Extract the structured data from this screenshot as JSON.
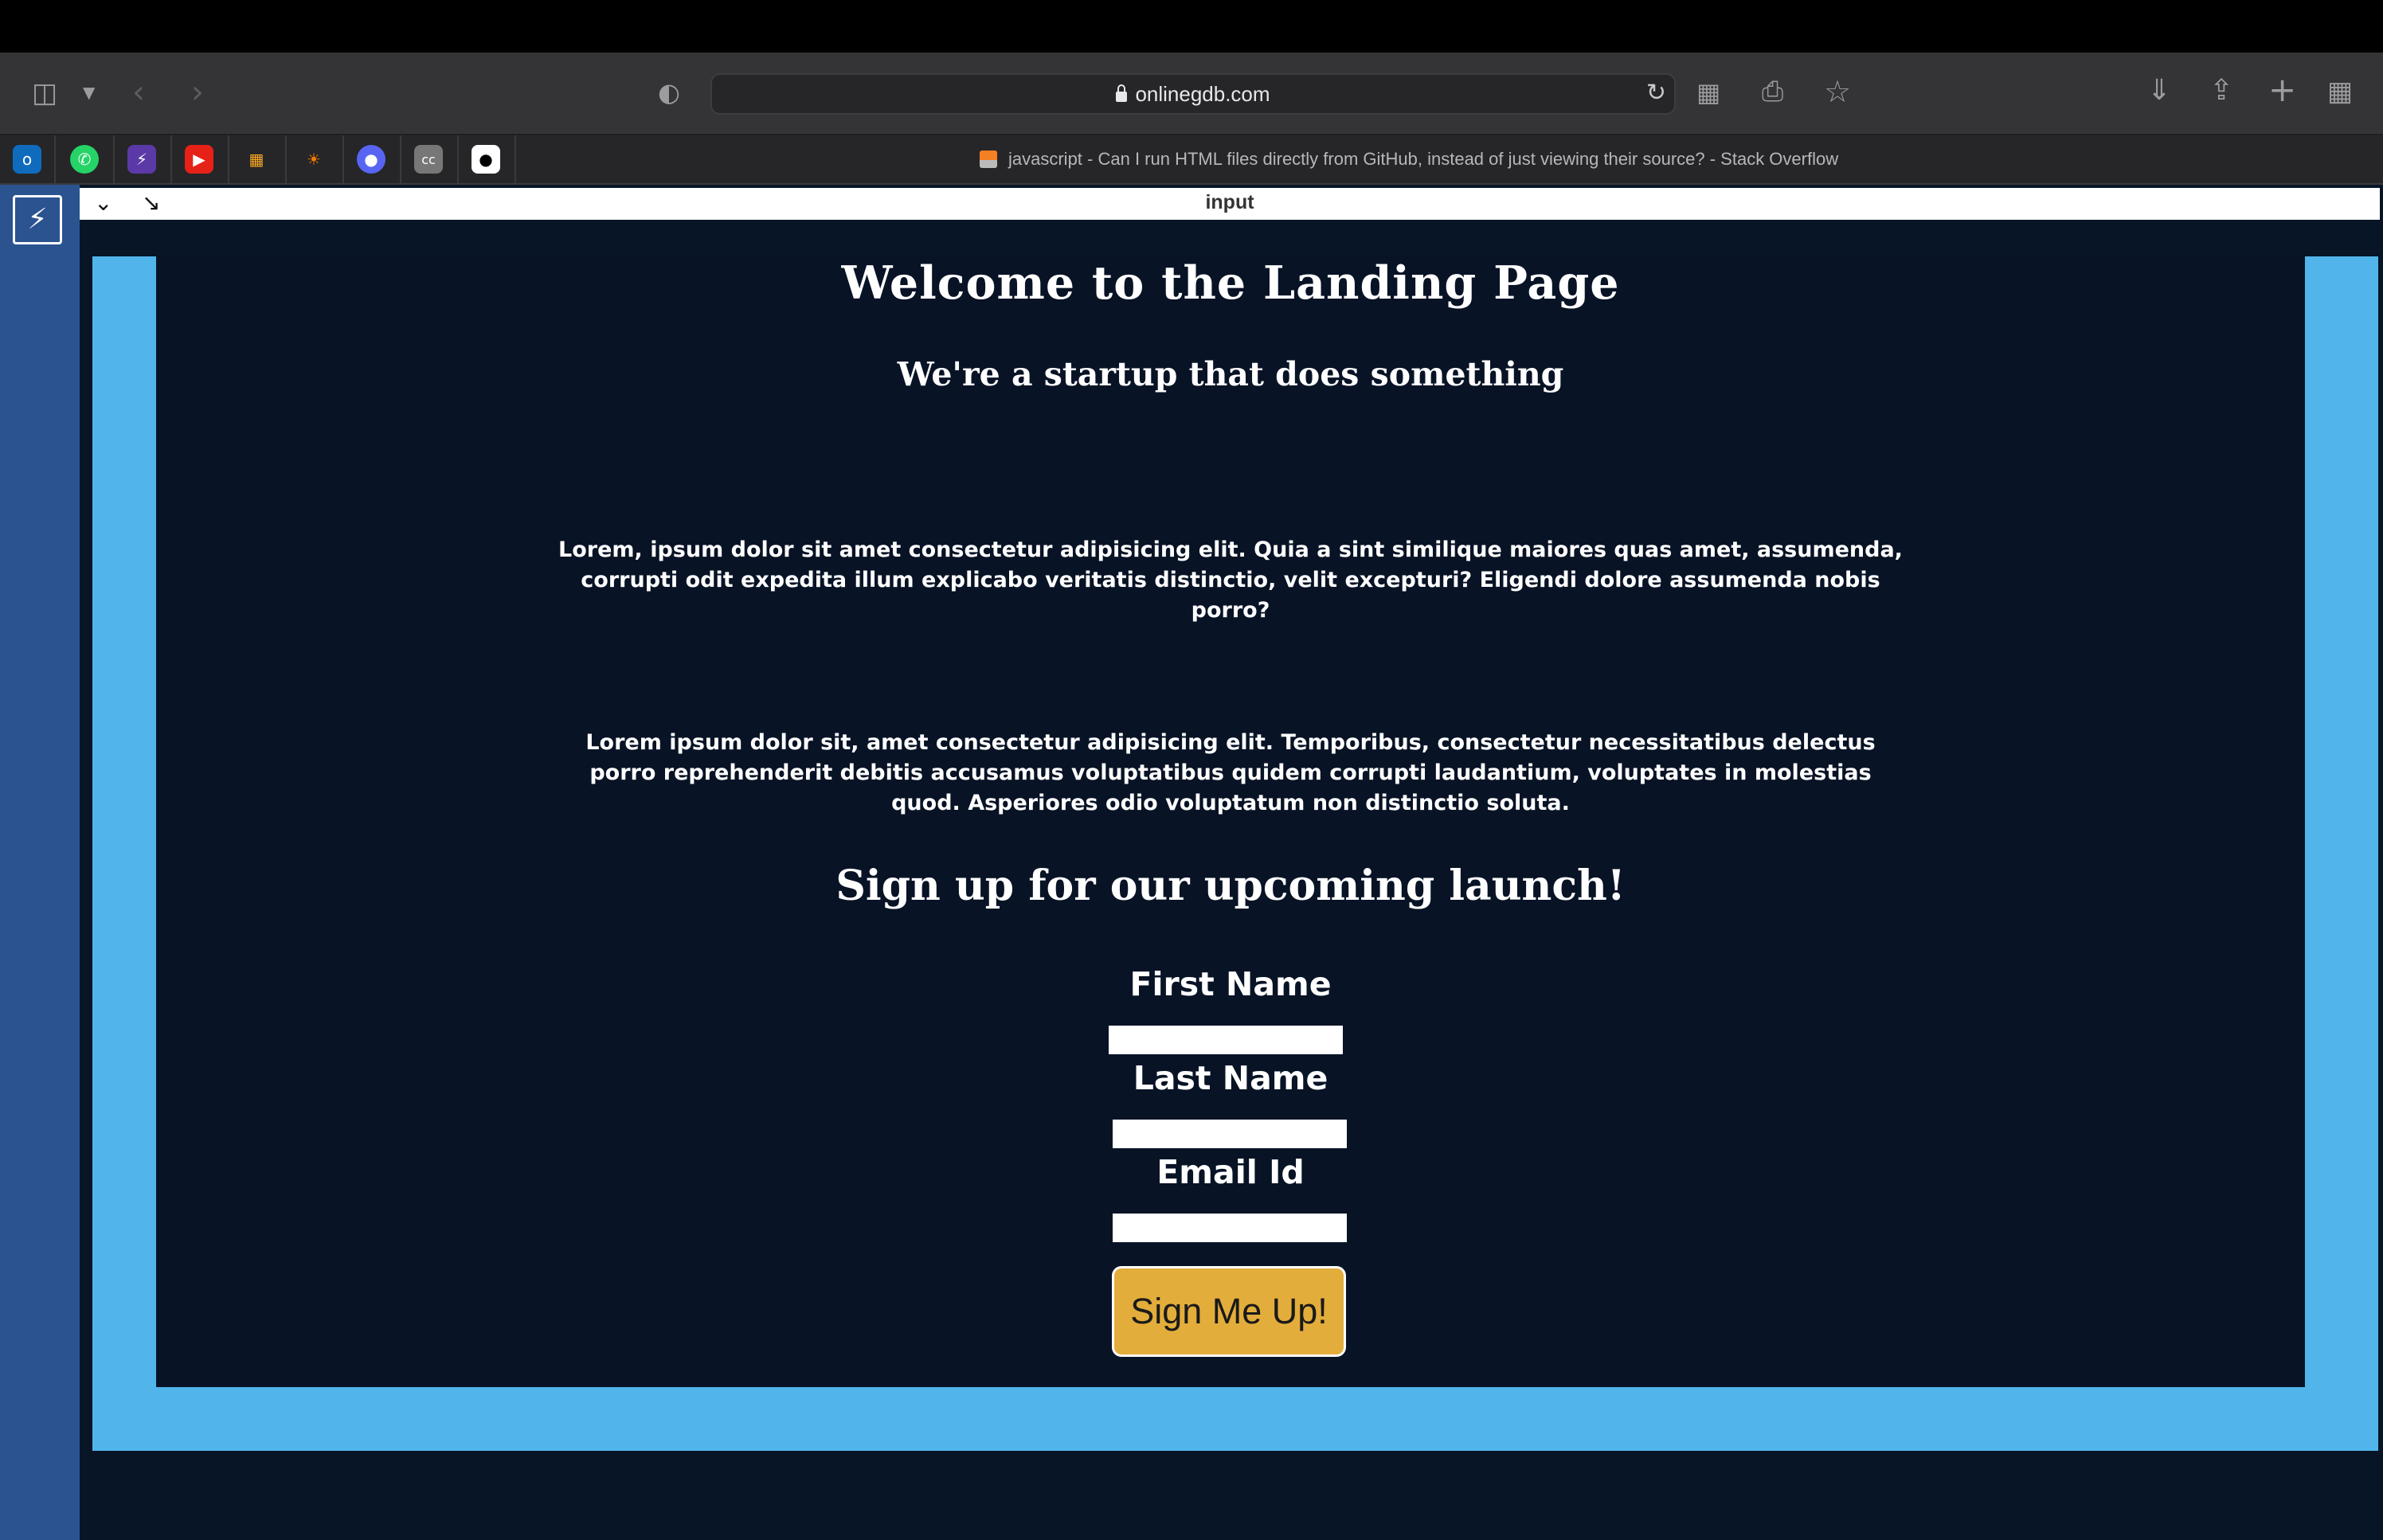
{
  "browser": {
    "url": "onlinegdb.com",
    "active_tab_title": "javascript - Can I run HTML files directly from GitHub, instead of just viewing their source? - Stack Overflow",
    "toolbar_icons": [
      "sidebar-icon",
      "chevron-down-icon",
      "back-icon",
      "forward-icon",
      "shield-icon",
      "lock-icon",
      "reload-icon",
      "grid-icon",
      "print-icon",
      "star-icon",
      "download-icon",
      "share-icon",
      "plus-icon",
      "tabs-overview-icon"
    ],
    "favorites": [
      "outlook",
      "whatsapp",
      "bolt",
      "youtube",
      "charts",
      "sun",
      "discord",
      "cc",
      "github"
    ]
  },
  "editor": {
    "panel_label": "input"
  },
  "landing": {
    "title": "Welcome to the Landing Page",
    "subtitle": "We're a startup that does something",
    "paragraph1": "Lorem, ipsum dolor sit amet consectetur adipisicing elit. Quia a sint similique maiores quas amet, assumenda, corrupti odit expedita illum explicabo veritatis distinctio, velit excepturi? Eligendi dolore assumenda nobis porro?",
    "paragraph2": "Lorem ipsum dolor sit, amet consectetur adipisicing elit. Temporibus, consectetur necessitatibus delectus porro reprehenderit debitis accusamus voluptatibus quidem corrupti laudantium, voluptates in molestias quod. Asperiores odio voluptatum non distinctio soluta.",
    "signup_heading": "Sign up for our upcoming launch!",
    "form": {
      "first_name_label": "First Name",
      "first_name_value": "",
      "last_name_label": "Last Name",
      "last_name_value": "",
      "email_label": "Email Id",
      "email_value": "",
      "submit_label": "Sign Me Up!"
    }
  },
  "colors": {
    "page_bg": "#081326",
    "frame_border": "#51b5ec",
    "button": "#e3ad3b",
    "sidebar": "#2a5390"
  }
}
